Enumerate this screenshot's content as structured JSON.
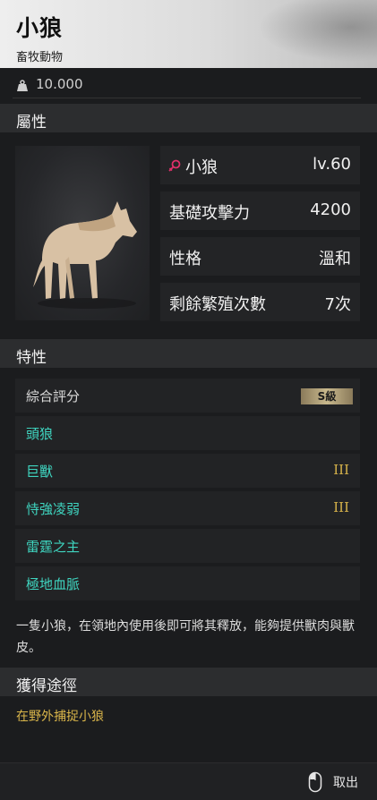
{
  "header": {
    "title": "小狼",
    "subtitle": "畜牧動物"
  },
  "weight": {
    "value": "10.000",
    "icon": "weight-icon"
  },
  "attributes": {
    "heading": "屬性",
    "stats": [
      {
        "label": "小狼",
        "value": "lv.60",
        "icon": "female-icon"
      },
      {
        "label": "基礎攻擊力",
        "value": "4200"
      },
      {
        "label": "性格",
        "value": "溫和"
      },
      {
        "label": "剩餘繁殖次數",
        "value": "7次"
      }
    ]
  },
  "traits": {
    "heading": "特性",
    "overall": {
      "label": "綜合評分",
      "grade": "S級"
    },
    "items": [
      {
        "name": "頭狼",
        "rank": ""
      },
      {
        "name": "巨獸",
        "rank": "III"
      },
      {
        "name": "恃強凌弱",
        "rank": "III"
      },
      {
        "name": "雷霆之主",
        "rank": ""
      },
      {
        "name": "極地血脈",
        "rank": ""
      }
    ]
  },
  "description": "一隻小狼，在領地內使用後即可將其釋放，能夠提供獸肉與獸皮。",
  "acquisition": {
    "heading": "獲得途徑",
    "method": "在野外捕捉小狼"
  },
  "footer": {
    "exit_label": "取出",
    "icon": "mouse-icon"
  },
  "colors": {
    "trait_name": "#3fd5c0",
    "rank": "#d6b24a",
    "gender": "#e0306a",
    "acquisition": "#d9b54a"
  }
}
